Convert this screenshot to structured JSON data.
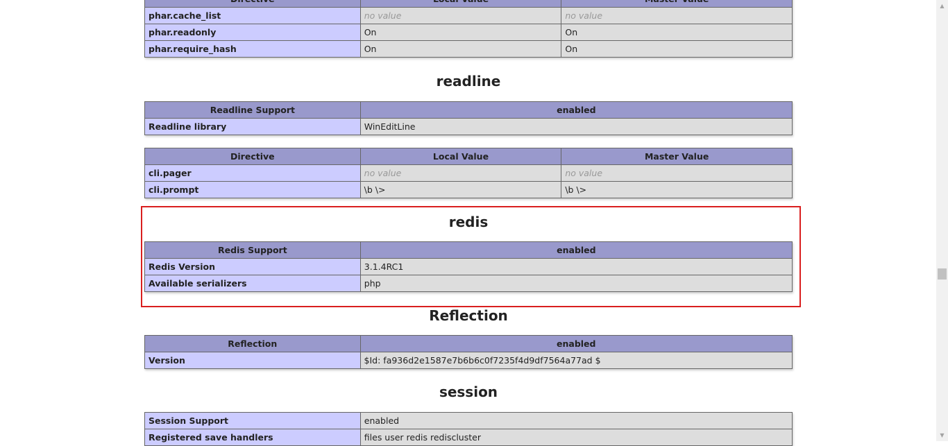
{
  "phar_directives": {
    "headers": [
      "Directive",
      "Local Value",
      "Master Value"
    ],
    "rows": [
      {
        "name": "phar.cache_list",
        "local": "no value",
        "master": "no value"
      },
      {
        "name": "phar.readonly",
        "local": "On",
        "master": "On"
      },
      {
        "name": "phar.require_hash",
        "local": "On",
        "master": "On"
      }
    ]
  },
  "readline": {
    "title": "readline",
    "info": {
      "header": [
        "Readline Support",
        "enabled"
      ],
      "rows": [
        {
          "name": "Readline library",
          "value": "WinEditLine"
        }
      ]
    },
    "directives": {
      "headers": [
        "Directive",
        "Local Value",
        "Master Value"
      ],
      "rows": [
        {
          "name": "cli.pager",
          "local": "no value",
          "master": "no value"
        },
        {
          "name": "cli.prompt",
          "local": "\\b \\> ",
          "master": "\\b \\> "
        }
      ]
    }
  },
  "redis": {
    "title": "redis",
    "highlight_color": "#d91e1e",
    "info": {
      "header": [
        "Redis Support",
        "enabled"
      ],
      "rows": [
        {
          "name": "Redis Version",
          "value": "3.1.4RC1"
        },
        {
          "name": "Available serializers",
          "value": "php"
        }
      ]
    }
  },
  "reflection": {
    "title": "Reflection",
    "info": {
      "header": [
        "Reflection",
        "enabled"
      ],
      "rows": [
        {
          "name": "Version",
          "value": "$Id: fa936d2e1587e7b6b6c0f7235f4d9df7564a77ad $"
        }
      ]
    }
  },
  "session": {
    "title": "session",
    "info": {
      "rows": [
        {
          "name": "Session Support",
          "value": "enabled"
        },
        {
          "name": "Registered save handlers",
          "value": "files user redis rediscluster"
        }
      ]
    }
  },
  "colors": {
    "header_bg": "#9999cc",
    "key_bg": "#ccccff",
    "value_bg": "#dddddd",
    "no_value_text": "#999999"
  },
  "icons": {
    "scroll_up": "▲",
    "scroll_down": "▼"
  }
}
